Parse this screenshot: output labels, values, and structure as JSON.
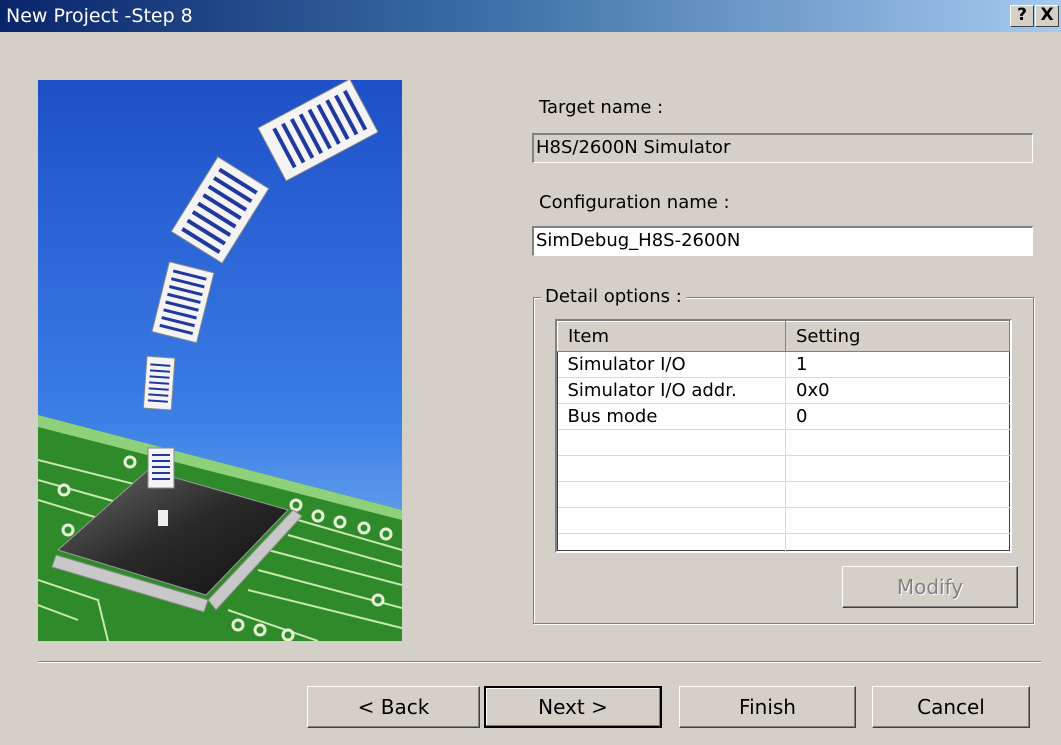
{
  "window": {
    "title": "New Project -Step 8",
    "help_button": "?",
    "close_button": "X"
  },
  "target": {
    "label": "Target name :",
    "value": "H8S/2600N Simulator"
  },
  "configuration": {
    "label": "Configuration name :",
    "value": "SimDebug_H8S-2600N"
  },
  "detail_options": {
    "label": "Detail options :",
    "columns": [
      "Item",
      "Setting"
    ],
    "rows": [
      [
        "Simulator I/O",
        "1"
      ],
      [
        "Simulator I/O addr.",
        "0x0"
      ],
      [
        "Bus mode",
        "0"
      ],
      [
        "",
        ""
      ],
      [
        "",
        ""
      ],
      [
        "",
        ""
      ],
      [
        "",
        ""
      ],
      [
        "",
        ""
      ]
    ],
    "modify_button": "Modify"
  },
  "buttons": {
    "back": "< Back",
    "next": "Next >",
    "finish": "Finish",
    "cancel": "Cancel"
  },
  "colors": {
    "titlebar_start": "#0a246a",
    "titlebar_end": "#a6caf0",
    "dialog_face": "#d4d0c8",
    "sky": "#2a64d8",
    "pcb_green": "#2f8a2a"
  },
  "icons": {
    "illustration": "wizard-chip-documents-illustration"
  }
}
